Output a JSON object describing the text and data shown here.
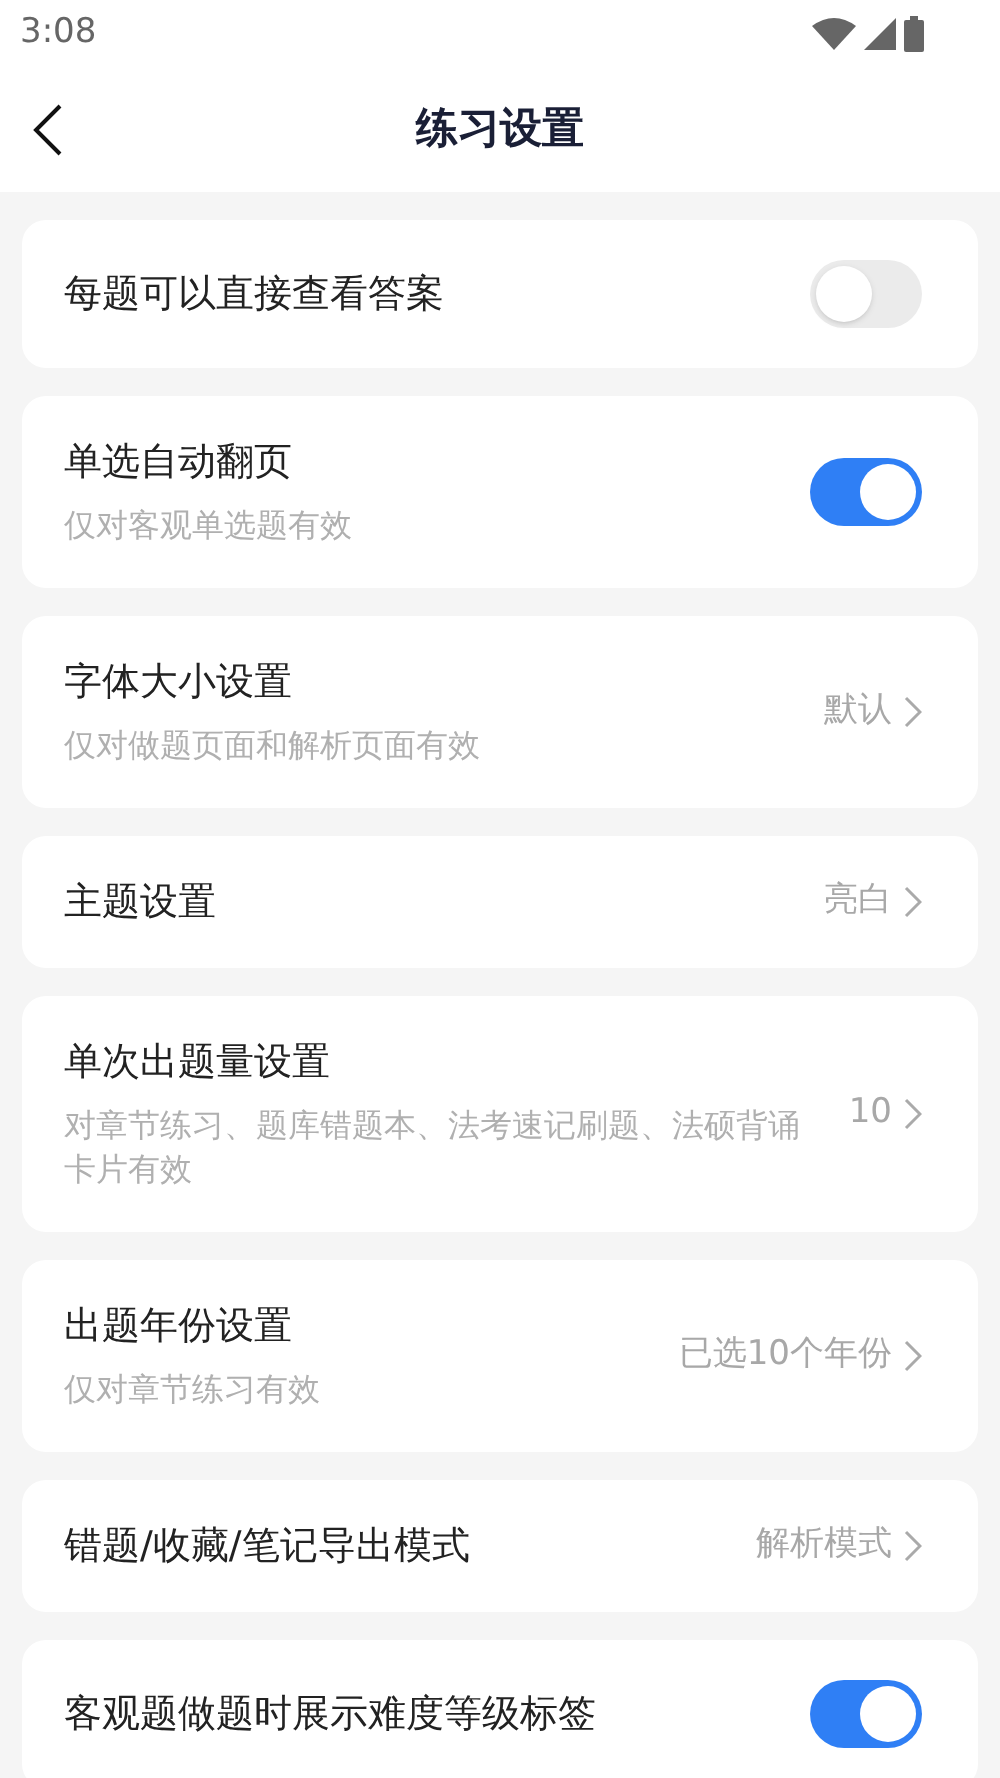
{
  "status_bar": {
    "time": "3:08"
  },
  "header": {
    "title": "练习设置"
  },
  "settings": [
    {
      "kind": "toggle",
      "title": "每题可以直接查看答案",
      "on": false
    },
    {
      "kind": "toggle",
      "title": "单选自动翻页",
      "subtitle": "仅对客观单选题有效",
      "on": true
    },
    {
      "kind": "link",
      "title": "字体大小设置",
      "subtitle": "仅对做题页面和解析页面有效",
      "value": "默认"
    },
    {
      "kind": "link",
      "title": "主题设置",
      "value": "亮白"
    },
    {
      "kind": "link",
      "title": "单次出题量设置",
      "subtitle": "对章节练习、题库错题本、法考速记刷题、法硕背诵卡片有效",
      "value": "10"
    },
    {
      "kind": "link",
      "title": "出题年份设置",
      "subtitle": "仅对章节练习有效",
      "value": "已选10个年份"
    },
    {
      "kind": "link",
      "title": "错题/收藏/笔记导出模式",
      "value": "解析模式"
    },
    {
      "kind": "toggle",
      "title": "客观题做题时展示难度等级标签",
      "on": true
    }
  ]
}
